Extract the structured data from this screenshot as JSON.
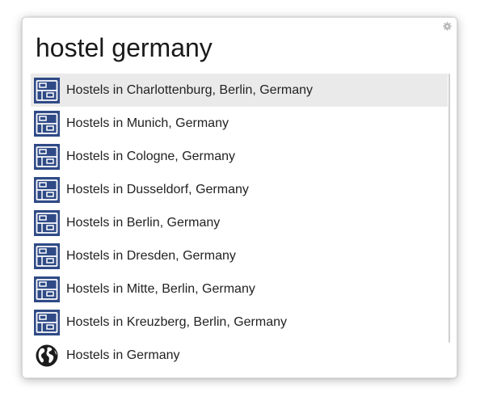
{
  "search": {
    "query": "hostel germany"
  },
  "colors": {
    "hostel_icon_bg": "#2f4a86",
    "selected_row_bg": "#eaeaea"
  },
  "results": [
    {
      "label": "Hostels in Charlottenburg, Berlin, Germany",
      "icon": "hostel-bed-icon",
      "selected": true
    },
    {
      "label": "Hostels in Munich, Germany",
      "icon": "hostel-bed-icon"
    },
    {
      "label": "Hostels in Cologne, Germany",
      "icon": "hostel-bed-icon"
    },
    {
      "label": "Hostels in Dusseldorf, Germany",
      "icon": "hostel-bed-icon"
    },
    {
      "label": "Hostels in Berlin, Germany",
      "icon": "hostel-bed-icon"
    },
    {
      "label": "Hostels in Dresden, Germany",
      "icon": "hostel-bed-icon"
    },
    {
      "label": "Hostels in Mitte, Berlin, Germany",
      "icon": "hostel-bed-icon"
    },
    {
      "label": "Hostels in Kreuzberg, Berlin, Germany",
      "icon": "hostel-bed-icon"
    },
    {
      "label": "Hostels in Germany",
      "icon": "globe-icon"
    }
  ]
}
